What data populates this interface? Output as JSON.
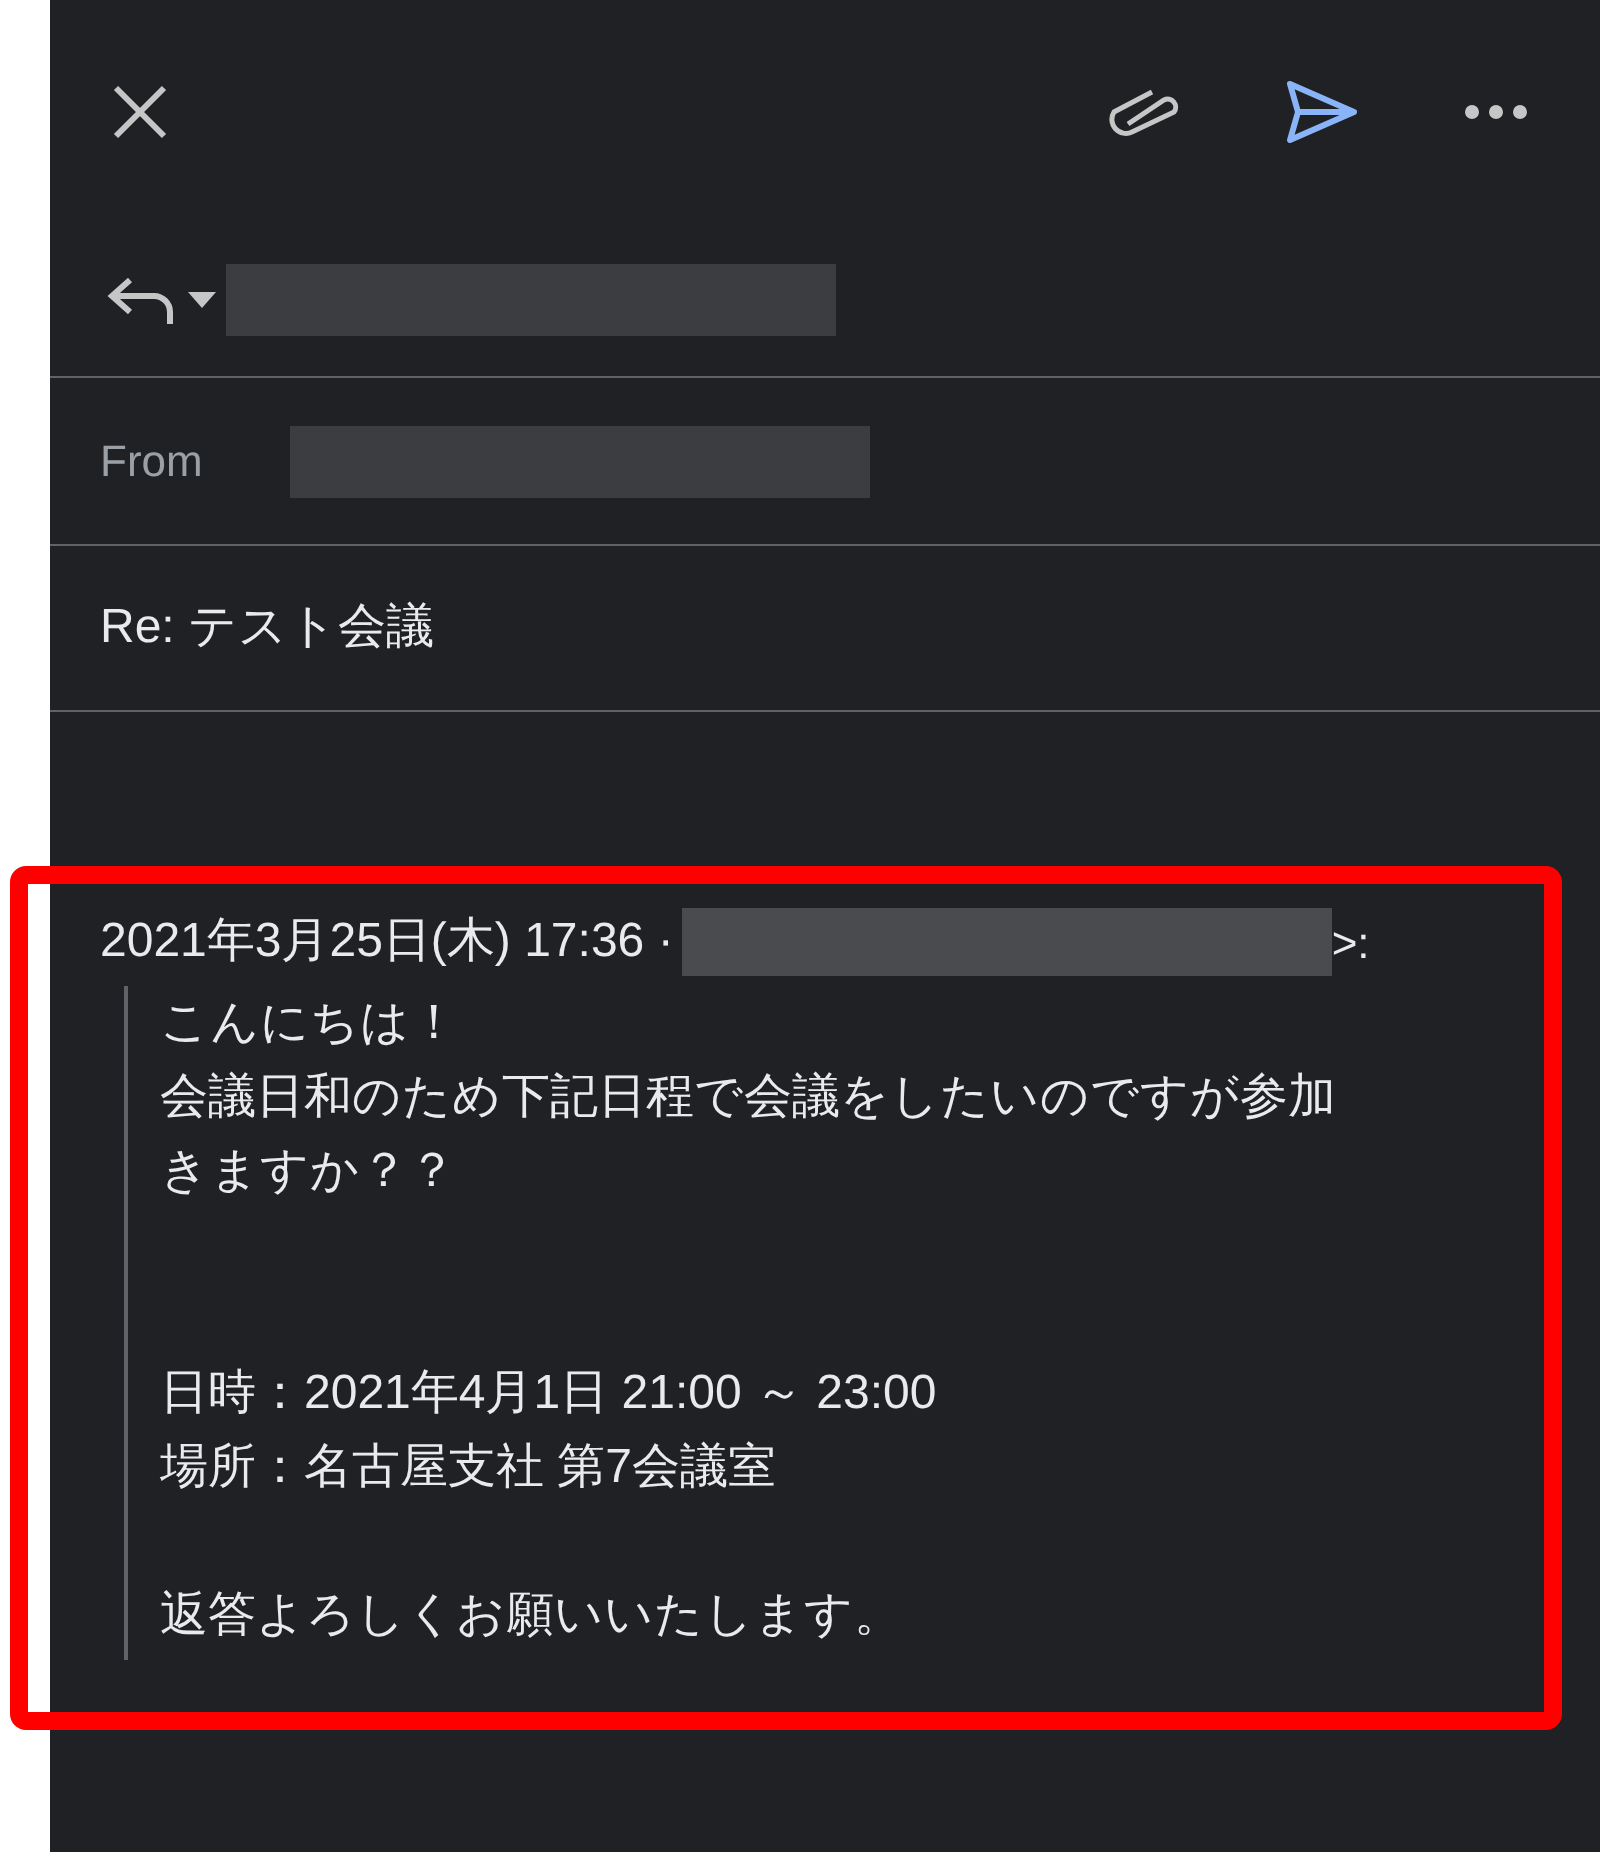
{
  "toolbar": {
    "send_active": true
  },
  "reply_row": {
    "redacted": true
  },
  "from_row": {
    "label": "From",
    "redacted": true
  },
  "subject": "Re: テスト会議",
  "quote": {
    "header_prefix": "2021年3月25日(木) 17:36 ·",
    "header_suffix": ">:",
    "lines": [
      {
        "kind": "line",
        "text": "こんにちは！"
      },
      {
        "kind": "line",
        "text": "会議日和のため下記日程で会議をしたいのですが参加"
      },
      {
        "kind": "line",
        "text": "きますか？？"
      },
      {
        "kind": "after_double_gap",
        "text": "日時：2021年4月1日 21:00 ～ 23:00"
      },
      {
        "kind": "line",
        "text": "場所：名古屋支社 第7会議室"
      },
      {
        "kind": "after_gap",
        "text": "返答よろしくお願いいたします。"
      }
    ]
  },
  "highlight": {
    "color": "#ff0000"
  }
}
